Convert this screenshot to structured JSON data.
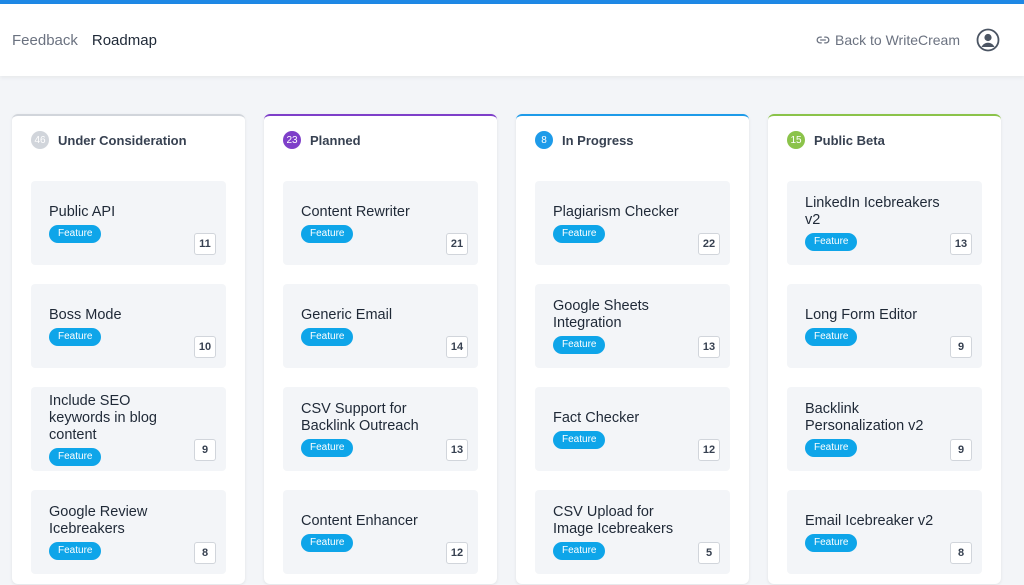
{
  "nav": {
    "feedback": "Feedback",
    "roadmap": "Roadmap"
  },
  "header": {
    "back_link": "Back to WriteCream"
  },
  "columns": [
    {
      "title": "Under Consideration",
      "count": "46",
      "color": "#d1d5db",
      "cards": [
        {
          "title": "Public API",
          "tag": "Feature",
          "votes": "11"
        },
        {
          "title": "Boss Mode",
          "tag": "Feature",
          "votes": "10"
        },
        {
          "title": "Include SEO keywords in blog content",
          "tag": "Feature",
          "votes": "9"
        },
        {
          "title": "Google Review Icebreakers",
          "tag": "Feature",
          "votes": "8"
        }
      ]
    },
    {
      "title": "Planned",
      "count": "23",
      "color": "#7e3fc9",
      "cards": [
        {
          "title": "Content Rewriter",
          "tag": "Feature",
          "votes": "21"
        },
        {
          "title": "Generic Email",
          "tag": "Feature",
          "votes": "14"
        },
        {
          "title": "CSV Support for Backlink Outreach",
          "tag": "Feature",
          "votes": "13"
        },
        {
          "title": "Content Enhancer",
          "tag": "Feature",
          "votes": "12"
        }
      ]
    },
    {
      "title": "In Progress",
      "count": "8",
      "color": "#1e9be9",
      "cards": [
        {
          "title": "Plagiarism Checker",
          "tag": "Feature",
          "votes": "22"
        },
        {
          "title": "Google Sheets Integration",
          "tag": "Feature",
          "votes": "13"
        },
        {
          "title": "Fact Checker",
          "tag": "Feature",
          "votes": "12"
        },
        {
          "title": "CSV Upload for Image Icebreakers",
          "tag": "Feature",
          "votes": "5"
        }
      ]
    },
    {
      "title": "Public Beta",
      "count": "15",
      "color": "#8bc34a",
      "cards": [
        {
          "title": "LinkedIn Icebreakers v2",
          "tag": "Feature",
          "votes": "13"
        },
        {
          "title": "Long Form Editor",
          "tag": "Feature",
          "votes": "9"
        },
        {
          "title": "Backlink Personalization v2",
          "tag": "Feature",
          "votes": "9"
        },
        {
          "title": "Email Icebreaker v2",
          "tag": "Feature",
          "votes": "8"
        }
      ]
    }
  ],
  "colors": {
    "accent": "#1e88e5",
    "tag": "#0ea5e9"
  }
}
